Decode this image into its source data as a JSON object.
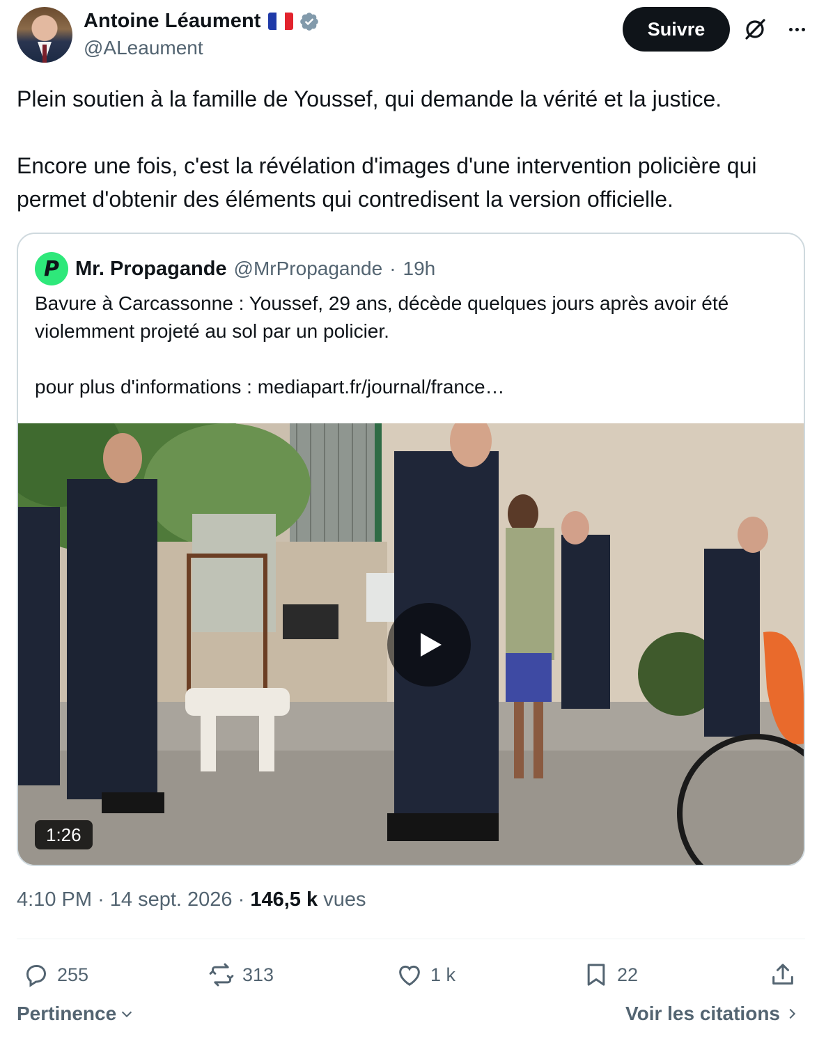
{
  "author": {
    "name": "Antoine Léaument",
    "handle": "@ALeaument",
    "flag_icon": "france-flag-icon",
    "verified_icon": "verified-badge-icon",
    "verified_color": "#829aab"
  },
  "header": {
    "follow_label": "Suivre",
    "grok_icon": "grok-icon",
    "more_icon": "more-icon"
  },
  "tweet": {
    "paragraphs": [
      "Plein soutien à la famille de Youssef, qui demande la vérité et la justice.",
      "Encore une fois, c'est la révélation d'images d'une intervention policière qui permet d'obtenir des éléments qui contredisent la version officielle."
    ]
  },
  "quote": {
    "avatar_letter": "P",
    "avatar_color": "#2ee87a",
    "name": "Mr. Propagande",
    "handle": "@MrPropagande",
    "separator": "·",
    "time": "19h",
    "paragraphs": [
      "Bavure à Carcassonne : Youssef, 29 ans, décède quelques jours après avoir été violemment projeté au sol par un policier.",
      "pour plus d'informations : mediapart.fr/journal/france…"
    ],
    "video": {
      "duration": "1:26",
      "play_icon": "play-icon"
    }
  },
  "meta": {
    "time": "4:10 PM",
    "separator": "·",
    "date": "14 sept. 2026",
    "views_count": "146,5 k",
    "views_label": "vues"
  },
  "actions": {
    "replies": "255",
    "reposts": "313",
    "likes": "1 k",
    "bookmarks": "22",
    "icons": [
      "reply-icon",
      "repost-icon",
      "like-icon",
      "bookmark-icon",
      "share-icon"
    ]
  },
  "footer": {
    "sort_label": "Pertinence",
    "quotes_label": "Voir les citations"
  },
  "colors": {
    "text_primary": "#0f1419",
    "text_secondary": "#536471",
    "border": "#cfd9de",
    "follow_button_bg": "#0f1419"
  }
}
